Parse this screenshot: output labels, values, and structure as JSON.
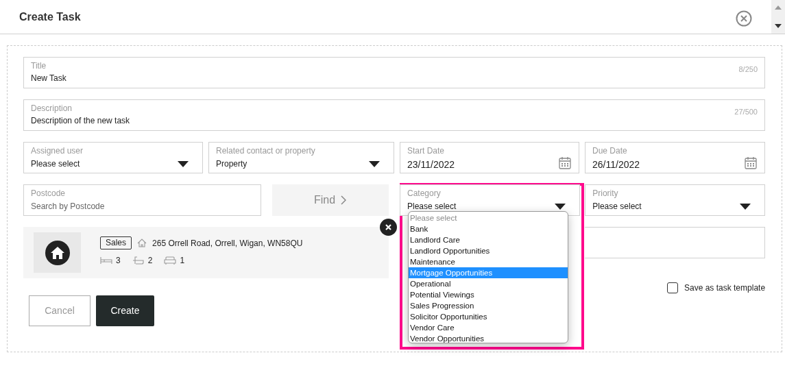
{
  "window": {
    "title": "Create Task"
  },
  "fields": {
    "title": {
      "label": "Title",
      "value": "New Task",
      "counter": "8/250"
    },
    "description": {
      "label": "Description",
      "value": "Description of the new task",
      "counter": "27/500"
    },
    "assigned_user": {
      "label": "Assigned user",
      "value": "Please select"
    },
    "related": {
      "label": "Related contact or property",
      "value": "Property"
    },
    "start_date": {
      "label": "Start Date",
      "value": "23/11/2022"
    },
    "due_date": {
      "label": "Due Date",
      "value": "26/11/2022"
    },
    "postcode": {
      "label": "Postcode",
      "placeholder": "Search by Postcode"
    },
    "category": {
      "label": "Category",
      "value": "Please select",
      "expanded": true
    },
    "priority": {
      "label": "Priority",
      "value": "Please select"
    }
  },
  "find_button": {
    "label": "Find",
    "disabled": true
  },
  "property": {
    "tag": "Sales",
    "address": "265 Orrell Road, Orrell, Wigan, WN58QU",
    "bedrooms": "3",
    "bathrooms": "2",
    "receptions": "1"
  },
  "category_options": [
    {
      "label": "Please select",
      "disabled": true,
      "selected": false
    },
    {
      "label": "Bank",
      "disabled": false,
      "selected": false
    },
    {
      "label": "Landlord Care",
      "disabled": false,
      "selected": false
    },
    {
      "label": "Landlord Opportunities",
      "disabled": false,
      "selected": false
    },
    {
      "label": "Maintenance",
      "disabled": false,
      "selected": false
    },
    {
      "label": "Mortgage Opportunities",
      "disabled": false,
      "selected": true
    },
    {
      "label": "Operational",
      "disabled": false,
      "selected": false
    },
    {
      "label": "Potential Viewings",
      "disabled": false,
      "selected": false
    },
    {
      "label": "Sales Progression",
      "disabled": false,
      "selected": false
    },
    {
      "label": "Solicitor Opportunities",
      "disabled": false,
      "selected": false
    },
    {
      "label": "Vendor Care",
      "disabled": false,
      "selected": false
    },
    {
      "label": "Vendor Opportunities",
      "disabled": false,
      "selected": false
    }
  ],
  "save_as_template": {
    "label": "Save as task template",
    "checked": false
  },
  "buttons": {
    "cancel": "Cancel",
    "create": "Create"
  }
}
